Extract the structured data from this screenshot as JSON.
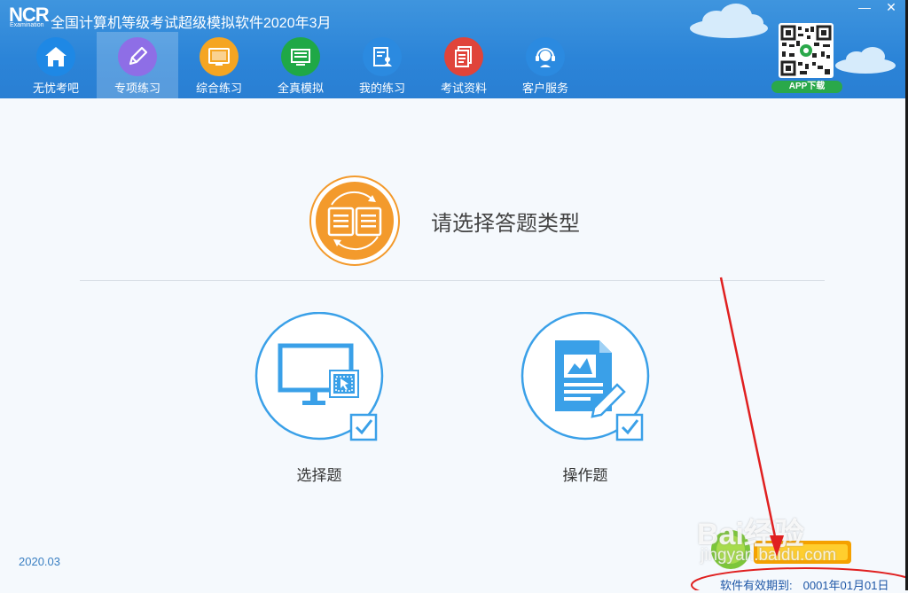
{
  "app": {
    "logo_text": "NCR",
    "logo_sub": "Examination",
    "title": "全国计算机等级考试超级模拟软件2020年3月",
    "minimize": "—",
    "close": "✕"
  },
  "nav": [
    {
      "label": "无忧考吧",
      "icon": "home-icon",
      "color": "#1e88e5"
    },
    {
      "label": "专项练习",
      "icon": "pencil-icon",
      "color": "#8e6ee6"
    },
    {
      "label": "综合练习",
      "icon": "screen-icon",
      "color": "#f5a522"
    },
    {
      "label": "全真模拟",
      "icon": "monitor-stack-icon",
      "color": "#1fa846"
    },
    {
      "label": "我的练习",
      "icon": "profile-doc-icon",
      "color": "#2b8ae0"
    },
    {
      "label": "考试资料",
      "icon": "document-icon",
      "color": "#e0443a"
    },
    {
      "label": "客户服务",
      "icon": "headset-icon",
      "color": "#2b8ae0"
    }
  ],
  "qr": {
    "download_label": "APP下载"
  },
  "main": {
    "prompt": "请选择答题类型",
    "options": [
      {
        "label": "选择题"
      },
      {
        "label": "操作题"
      }
    ]
  },
  "footer": {
    "version": "2020.03",
    "expiry_label": "软件有效期到:",
    "expiry_date": "0001年01月01日"
  },
  "overlay": {
    "watermark": "Bai经验",
    "watermark_sub": "jingyan.baidu.com"
  },
  "colors": {
    "header": "#2b84d8",
    "accent_orange": "#f39a2c",
    "option_blue": "#3aa0e8",
    "annotation_red": "#e02020"
  }
}
